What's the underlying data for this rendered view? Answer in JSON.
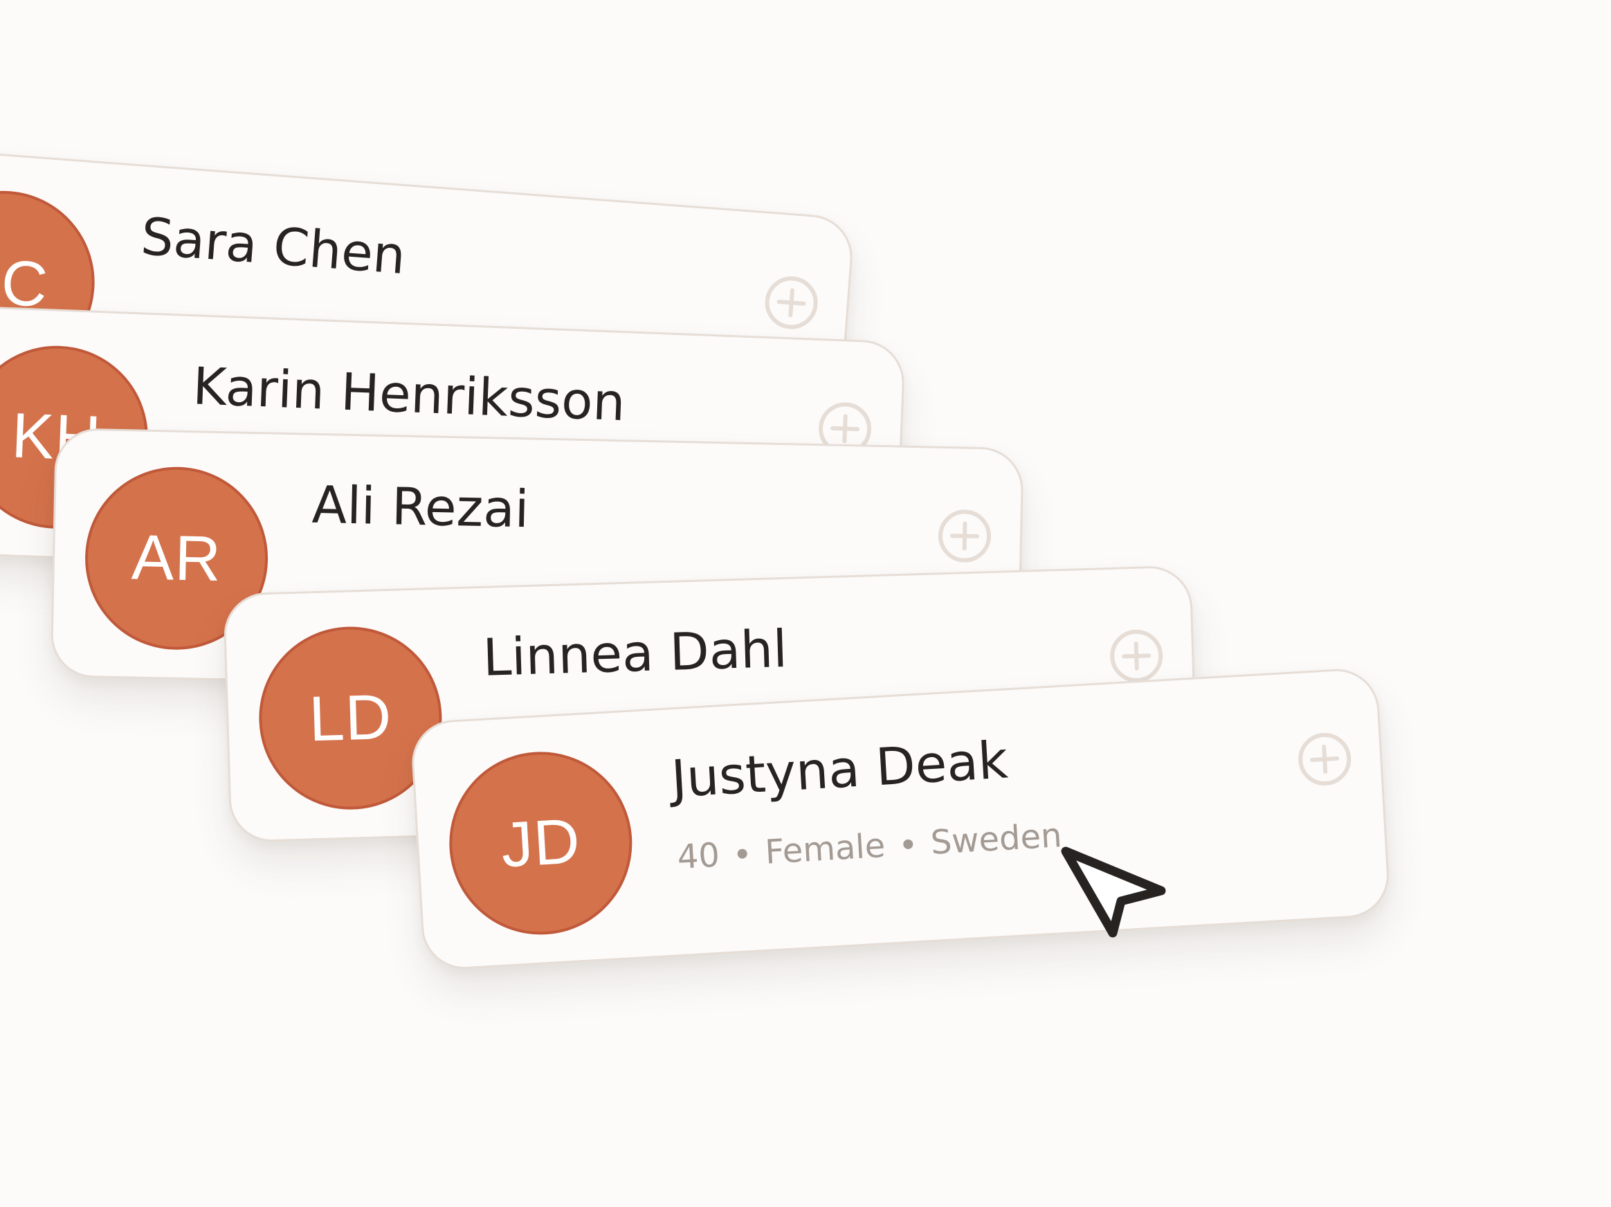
{
  "people": [
    {
      "initials": "SC",
      "name": "Sara Chen"
    },
    {
      "initials": "KH",
      "name": "Karin Henriksson"
    },
    {
      "initials": "AR",
      "name": "Ali Rezai"
    },
    {
      "initials": "LD",
      "name": "Linnea Dahl"
    },
    {
      "initials": "JD",
      "name": "Justyna Deak",
      "age": "40",
      "gender": "Female",
      "country": "Sweden"
    }
  ],
  "icons": {
    "add": "plus-circle-icon",
    "cursor": "mouse-pointer-icon"
  },
  "colors": {
    "background": "#fcfbfa",
    "avatar": "#d4724b",
    "avatar_border": "#c0593a",
    "card_border": "#e6ddd6",
    "name_text": "#262321",
    "meta_text": "#a39a93"
  }
}
